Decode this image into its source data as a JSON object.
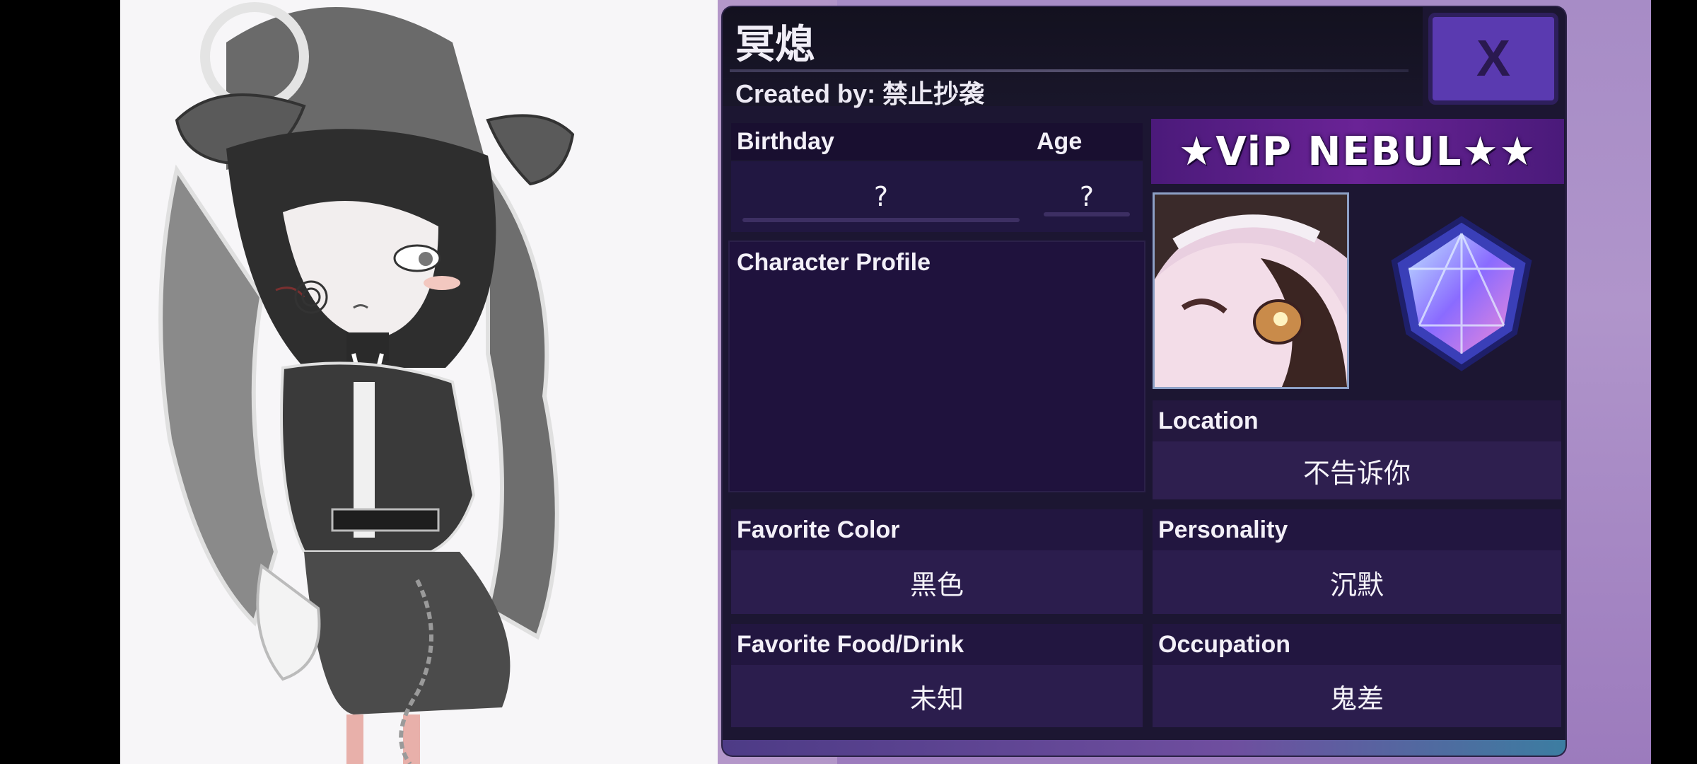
{
  "character": {
    "name": "冥熄",
    "created_by": "Created by: 禁止抄袭"
  },
  "close_button": {
    "label": "X"
  },
  "fields": {
    "birthday": {
      "label": "Birthday",
      "value": "?"
    },
    "age": {
      "label": "Age",
      "value": "?"
    },
    "profile": {
      "label": "Character Profile",
      "value": ""
    },
    "location": {
      "label": "Location",
      "value": "不告诉你"
    },
    "favorite_color": {
      "label": "Favorite Color",
      "value": "黑色"
    },
    "personality": {
      "label": "Personality",
      "value": "沉默"
    },
    "favorite_food": {
      "label": "Favorite Food/Drink",
      "value": "未知"
    },
    "occupation": {
      "label": "Occupation",
      "value": "鬼差"
    }
  },
  "badge": {
    "text": "★ViP NEBUL★★",
    "icon": "diamond-gem-icon"
  },
  "colors": {
    "panel": "#1c1632",
    "accent": "#5a3ab0",
    "field": "#2a1c4a"
  }
}
